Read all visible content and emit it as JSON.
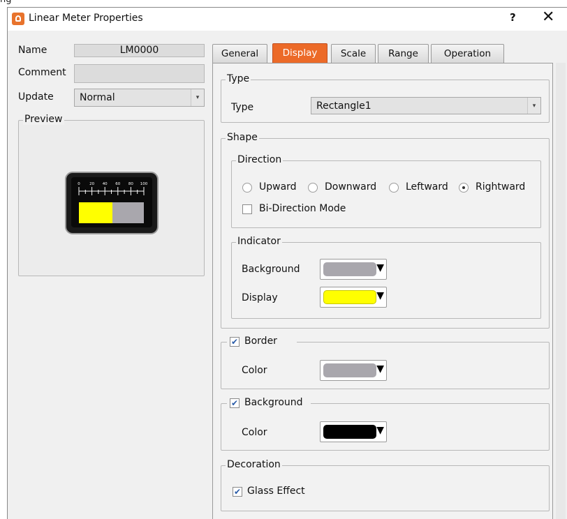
{
  "top_strip_text": "ng",
  "window": {
    "title": "Linear Meter Properties",
    "help": "?",
    "close": "✕"
  },
  "left": {
    "name_label": "Name",
    "name_value": "LM0000",
    "comment_label": "Comment",
    "comment_value": "",
    "update_label": "Update",
    "update_value": "Normal",
    "preview_label": "Preview",
    "preview_scale": [
      "0",
      "20",
      "40",
      "60",
      "80",
      "100"
    ]
  },
  "tabs": [
    {
      "label": "General",
      "active": false
    },
    {
      "label": "Display",
      "active": true
    },
    {
      "label": "Scale",
      "active": false
    },
    {
      "label": "Range",
      "active": false
    },
    {
      "label": "Operation",
      "active": false
    }
  ],
  "display": {
    "type_group": "Type",
    "type_label": "Type",
    "type_value": "Rectangle1",
    "shape_group": "Shape",
    "direction_group": "Direction",
    "directions": [
      {
        "label": "Upward",
        "selected": false
      },
      {
        "label": "Downward",
        "selected": false
      },
      {
        "label": "Leftward",
        "selected": false
      },
      {
        "label": "Rightward",
        "selected": true
      }
    ],
    "bidirection_label": "Bi-Direction Mode",
    "bidirection_checked": false,
    "indicator_group": "Indicator",
    "background_label": "Background",
    "background_color": "#a9a7ad",
    "display_label": "Display",
    "display_color": "#ffff00",
    "border_group": "Border",
    "border_checked": true,
    "border_color_label": "Color",
    "border_color": "#a9a7ad",
    "bg_group": "Background",
    "bg_checked": true,
    "bg_color_label": "Color",
    "bg_color": "#000000",
    "decoration_group": "Decoration",
    "glass_label": "Glass Effect",
    "glass_checked": true
  }
}
